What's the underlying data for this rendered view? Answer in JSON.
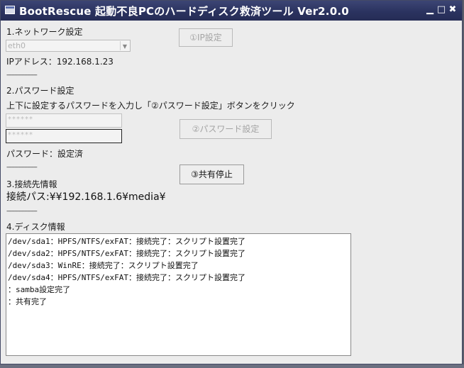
{
  "window": {
    "title": "BootRescue 起動不良PCのハードディスク救済ツール Ver2.0.0",
    "buttons": {
      "minimize": "▁",
      "maximize": "□",
      "close": "✖"
    }
  },
  "network": {
    "heading": "1.ネットワーク設定",
    "interface_value": "eth0",
    "ip_label": "IPアドレス：192.168.1.23",
    "ip_button": "①IP設定"
  },
  "separator": "-------------------",
  "password": {
    "heading": "2.パスワード設定",
    "instruction": "上下に設定するパスワードを入力し「②パスワード設定」ボタンをクリック",
    "field1_mask": "******",
    "field2_mask": "******",
    "set_button": "②パスワード設定",
    "status": "パスワード：設定済"
  },
  "connection": {
    "stop_button": "③共有停止",
    "heading": "3.接続先情報",
    "path": "接続パス:¥¥192.168.1.6¥media¥"
  },
  "disk": {
    "heading": "4.ディスク情報",
    "log": [
      "/dev/sda1：HPFS/NTFS/exFAT：接続完了：スクリプト設置完了",
      "/dev/sda2：HPFS/NTFS/exFAT：接続完了：スクリプト設置完了",
      "/dev/sda3：WinRE：接続完了：スクリプト設置完了",
      "/dev/sda4：HPFS/NTFS/exFAT：接続完了：スクリプト設置完了",
      "：samba設定完了",
      "：共有完了"
    ]
  }
}
